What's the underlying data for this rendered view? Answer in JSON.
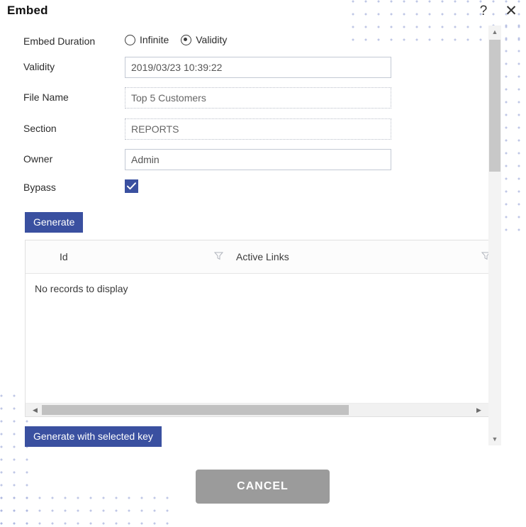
{
  "dialog": {
    "title": "Embed",
    "help_icon": "?",
    "close_icon": "✕"
  },
  "form": {
    "embed_duration": {
      "label": "Embed Duration",
      "options": [
        {
          "label": "Infinite",
          "selected": false
        },
        {
          "label": "Validity",
          "selected": true
        }
      ]
    },
    "validity": {
      "label": "Validity",
      "value": "2019/03/23 10:39:22",
      "placeholder": ""
    },
    "file_name": {
      "label": "File Name",
      "value": "Top 5 Customers",
      "placeholder": ""
    },
    "section": {
      "label": "Section",
      "value": "REPORTS",
      "placeholder": ""
    },
    "owner": {
      "label": "Owner",
      "value": "Admin",
      "placeholder": ""
    },
    "bypass": {
      "label": "Bypass",
      "checked": true
    }
  },
  "actions": {
    "generate_label": "Generate",
    "generate_with_selected_key_label": "Generate with selected key",
    "cancel_label": "CANCEL"
  },
  "grid": {
    "columns": [
      {
        "header": "Id",
        "filter_icon": "filter-icon"
      },
      {
        "header": "Active Links",
        "filter_icon": "filter-icon"
      }
    ],
    "rows": [],
    "empty_message": "No records to display",
    "hscroll": {
      "left_arrow": "◀",
      "right_arrow": "▶"
    }
  },
  "scrollbar": {
    "up_arrow": "▲",
    "down_arrow": "▼"
  },
  "colors": {
    "accent_blue": "#3a50a0",
    "cancel_gray": "#9b9b9b",
    "dot_pattern": "#aab4de"
  }
}
